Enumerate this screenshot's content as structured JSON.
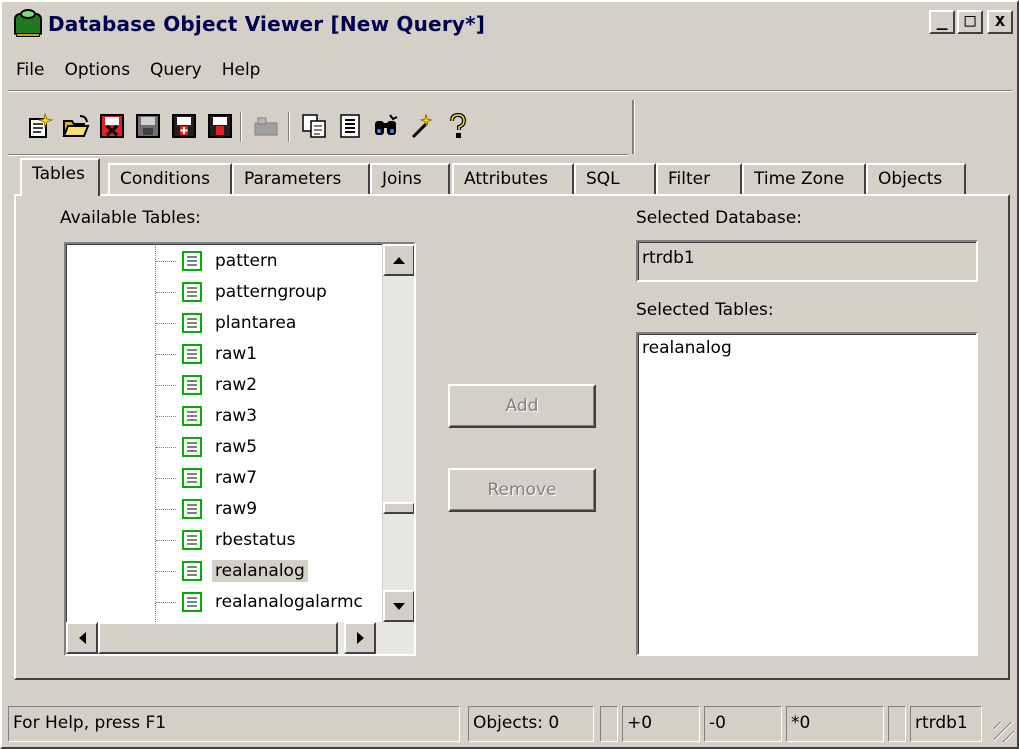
{
  "window": {
    "title": "Database Object Viewer [New Query*]",
    "controls": [
      "_",
      "□",
      "x"
    ]
  },
  "menu": [
    "File",
    "Options",
    "Query",
    "Help"
  ],
  "toolbar": {
    "buttons": [
      "new-query-icon",
      "open-folder-icon",
      "delete-icon",
      "save-icon",
      "save-as-icon",
      "save-all-icon",
      "disabled-icon",
      "copy-icon",
      "list-icon",
      "find-icon",
      "wand-icon",
      "help-icon"
    ]
  },
  "tabs": [
    "Tables",
    "Conditions",
    "Parameters",
    "Joins",
    "Attributes",
    "SQL",
    "Filter",
    "Time Zone",
    "Objects"
  ],
  "tables_tab": {
    "available_label": "Available Tables:",
    "available_items": [
      "pattern",
      "patterngroup",
      "plantarea",
      "raw1",
      "raw2",
      "raw3",
      "raw5",
      "raw7",
      "raw9",
      "rbestatus",
      "realanalog",
      "realanalogalarmc"
    ],
    "selected_item": "realanalog",
    "add_label": "Add",
    "remove_label": "Remove",
    "db_label": "Selected Database:",
    "db_value": "rtrdb1",
    "selected_tables_label": "Selected Tables:",
    "selected_tables": [
      "realanalog"
    ]
  },
  "status": {
    "help": "For Help, press F1",
    "objects": "Objects: 0",
    "plus": "+0",
    "minus": "-0",
    "star": "*0",
    "db": "rtrdb1"
  }
}
